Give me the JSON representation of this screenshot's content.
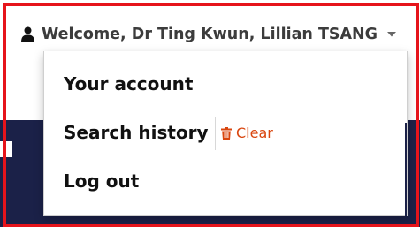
{
  "account_menu": {
    "welcome_label": "Welcome, Dr Ting Kwun, Lillian TSANG",
    "user_icon": "user-icon",
    "caret_icon": "caret-down-icon"
  },
  "dropdown": {
    "items": [
      {
        "label": "Your account"
      },
      {
        "label": "Search history"
      },
      {
        "label": "Log out"
      }
    ],
    "clear_action": {
      "label": "Clear",
      "icon": "trash-icon",
      "color": "#d9460f"
    }
  },
  "colors": {
    "highlight": "#e6141b",
    "navy_background": "#1b2148",
    "text_dark": "#111111",
    "toggle_text": "#3c3c3c"
  }
}
